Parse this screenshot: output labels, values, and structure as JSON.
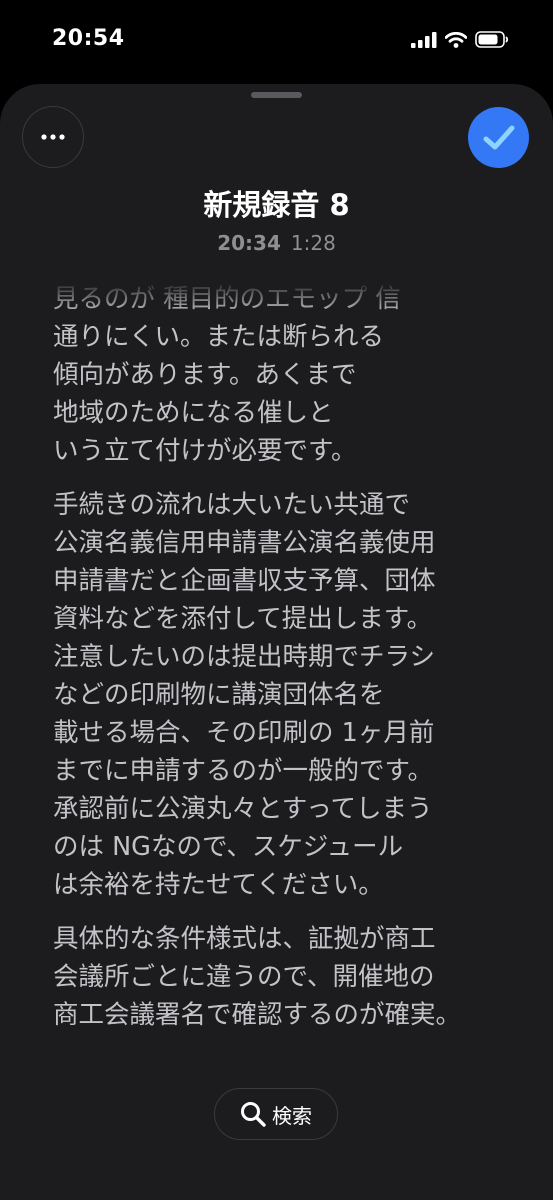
{
  "status_bar": {
    "time": "20:54"
  },
  "recording": {
    "title": "新規録音 8",
    "time": "20:34",
    "duration": "1:28"
  },
  "transcript": {
    "partial_line": "見るのが 種目的のエモップ 信",
    "paragraphs": [
      {
        "lines": [
          "通りにくい。または断られる",
          "傾向があります。あくまで",
          "地域のためになる催しと",
          "いう立て付けが必要です。"
        ]
      },
      {
        "lines": [
          "手続きの流れは大いたい共通で",
          "公演名義信用申請書公演名義使用",
          "申請書だと企画書収支予算、団体",
          "資料などを添付して提出します。",
          "注意したいのは提出時期でチラシ",
          "などの印刷物に講演団体名を",
          "載せる場合、その印刷の 1ヶ月前",
          "までに申請するのが一般的です。",
          "承認前に公演丸々とすってしまう",
          "のは NGなので、スケジュール",
          "は余裕を持たせてください。"
        ]
      },
      {
        "lines": [
          "具体的な条件様式は、証拠が商工",
          "会議所ごとに違うので、開催地の",
          "商工会議署名で確認するのが確実。"
        ]
      }
    ]
  },
  "search_button": {
    "label": "検索"
  },
  "icons": {
    "more": "ellipsis-icon",
    "done": "checkmark-icon",
    "search": "magnifier-icon",
    "signal": "cellular-signal-icon",
    "wifi": "wifi-icon",
    "battery": "battery-icon"
  },
  "colors": {
    "accent": "#3478f6",
    "sheet": "#1c1c1e",
    "check": "#8fd3ff"
  }
}
